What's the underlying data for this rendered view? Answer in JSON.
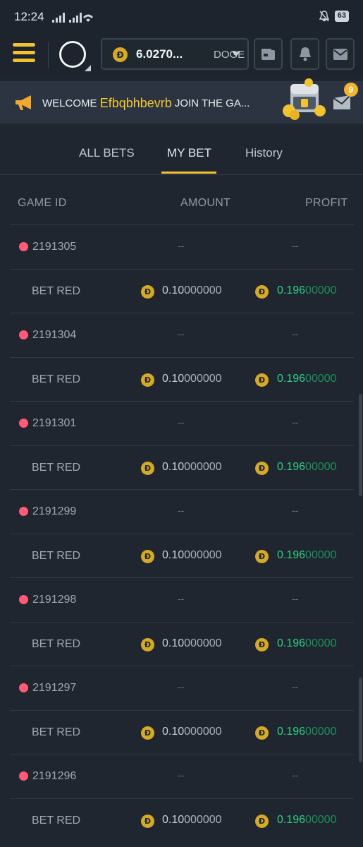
{
  "status": {
    "time": "12:24",
    "battery": "63"
  },
  "header": {
    "balance": "6.0270...",
    "currency": "DOGE",
    "coin_symbol": "Ð"
  },
  "banner": {
    "welcome": "WELCOME ",
    "username": "Efbqbhbevrb",
    "cta": " JOIN THE GA...",
    "notification_count": "9"
  },
  "tabs": [
    {
      "label": "ALL BETS"
    },
    {
      "label": "MY BET"
    },
    {
      "label": "History"
    }
  ],
  "table": {
    "columns": [
      "GAME ID",
      "AMOUNT",
      "PROFIT"
    ],
    "placeholder": "--",
    "games": [
      {
        "id": "2191305",
        "bet": "BET RED",
        "amount_main": "0.10",
        "amount_rest": "000000",
        "profit_main": "0.196",
        "profit_rest": "00000"
      },
      {
        "id": "2191304",
        "bet": "BET RED",
        "amount_main": "0.10",
        "amount_rest": "000000",
        "profit_main": "0.196",
        "profit_rest": "00000"
      },
      {
        "id": "2191301",
        "bet": "BET RED",
        "amount_main": "0.10",
        "amount_rest": "000000",
        "profit_main": "0.196",
        "profit_rest": "00000"
      },
      {
        "id": "2191299",
        "bet": "BET RED",
        "amount_main": "0.10",
        "amount_rest": "000000",
        "profit_main": "0.196",
        "profit_rest": "00000"
      },
      {
        "id": "2191298",
        "bet": "BET RED",
        "amount_main": "0.10",
        "amount_rest": "000000",
        "profit_main": "0.196",
        "profit_rest": "00000"
      },
      {
        "id": "2191297",
        "bet": "BET RED",
        "amount_main": "0.10",
        "amount_rest": "000000",
        "profit_main": "0.196",
        "profit_rest": "00000"
      },
      {
        "id": "2191296",
        "bet": "BET RED",
        "amount_main": "0.10",
        "amount_rest": "000000",
        "profit_main": "0.196",
        "profit_rest": "00000"
      }
    ]
  },
  "colors": {
    "accent": "#f2c230",
    "profit": "#2fd083",
    "loss_dot": "#ff5a78",
    "background": "#1f262f"
  }
}
